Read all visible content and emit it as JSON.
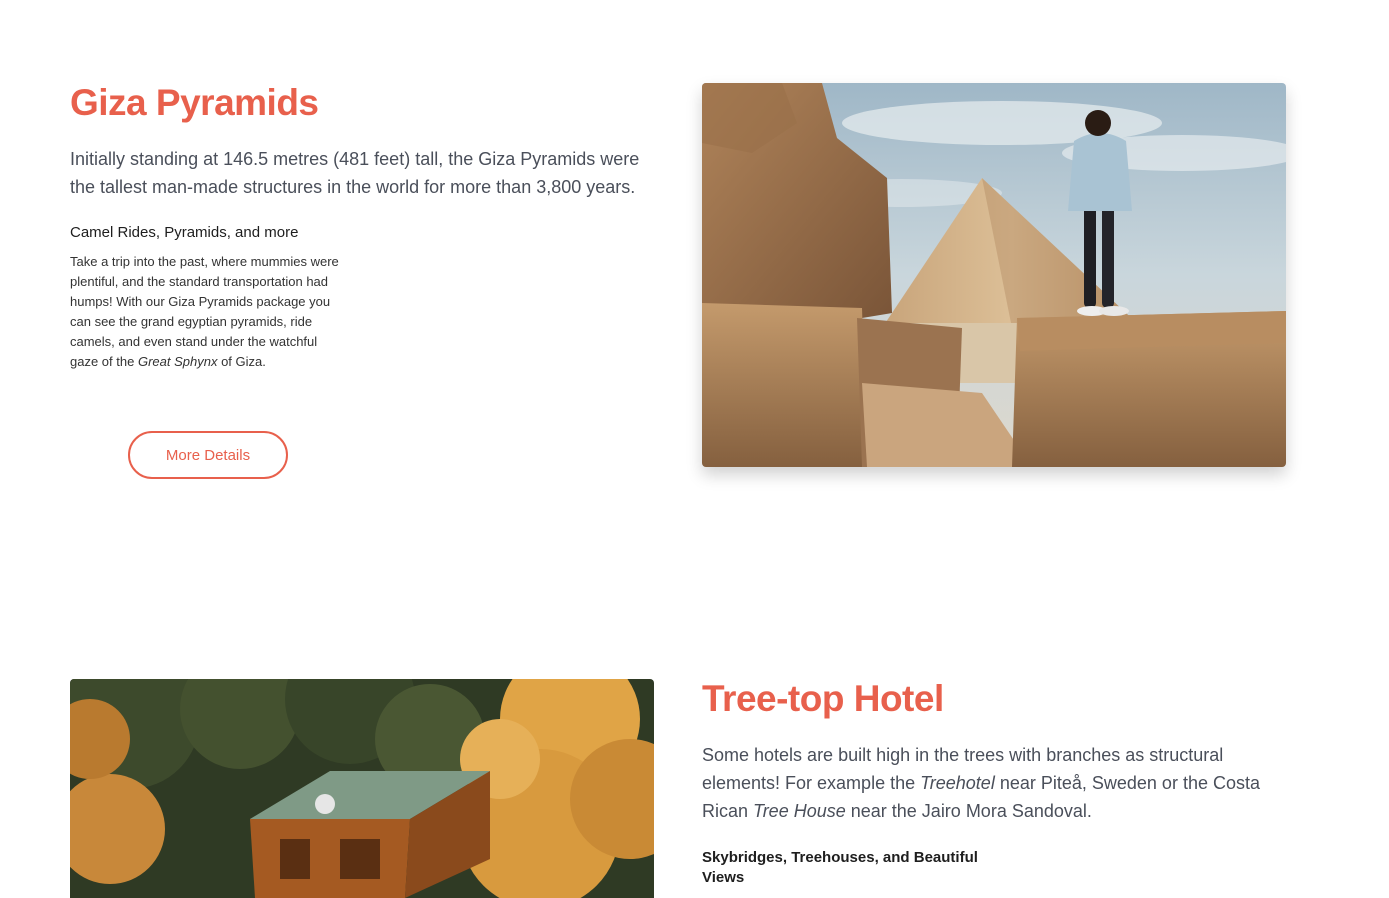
{
  "giza": {
    "title": "Giza Pyramids",
    "lead": "Initially standing at 146.5 metres (481 feet) tall, the Giza Pyramids were the tallest man-made structures in the world for more than 3,800 years.",
    "subtitle": "Camel Rides, Pyramids, and more",
    "body_part1": "Take a trip into the past, where mummies were plentiful, and the standard transportation had humps! With our Giza Pyramids package you can see the grand egyptian pyramids, ride camels, and even stand under the watchful gaze of the ",
    "body_emphasis": "Great Sphynx",
    "body_part2": " of Giza.",
    "button_label": "More Details",
    "photo_alt": "Person standing on ancient stone blocks looking at a pyramid"
  },
  "treetop": {
    "title": "Tree-top Hotel",
    "lead_part1": "Some hotels are built high in the trees with branches as structural elements! For example the ",
    "lead_em1": "Treehotel",
    "lead_part2": " near Piteå, Sweden or the Costa Rican ",
    "lead_em2": "Tree House",
    "lead_part3": " near the Jairo Mora Sandoval.",
    "subtitle": "Skybridges, Treehouses, and Beautiful Views",
    "photo_alt": "Wooden cabin among autumn trees"
  },
  "colors": {
    "accent": "#e8604c",
    "lead_text": "#4a4f5a"
  }
}
